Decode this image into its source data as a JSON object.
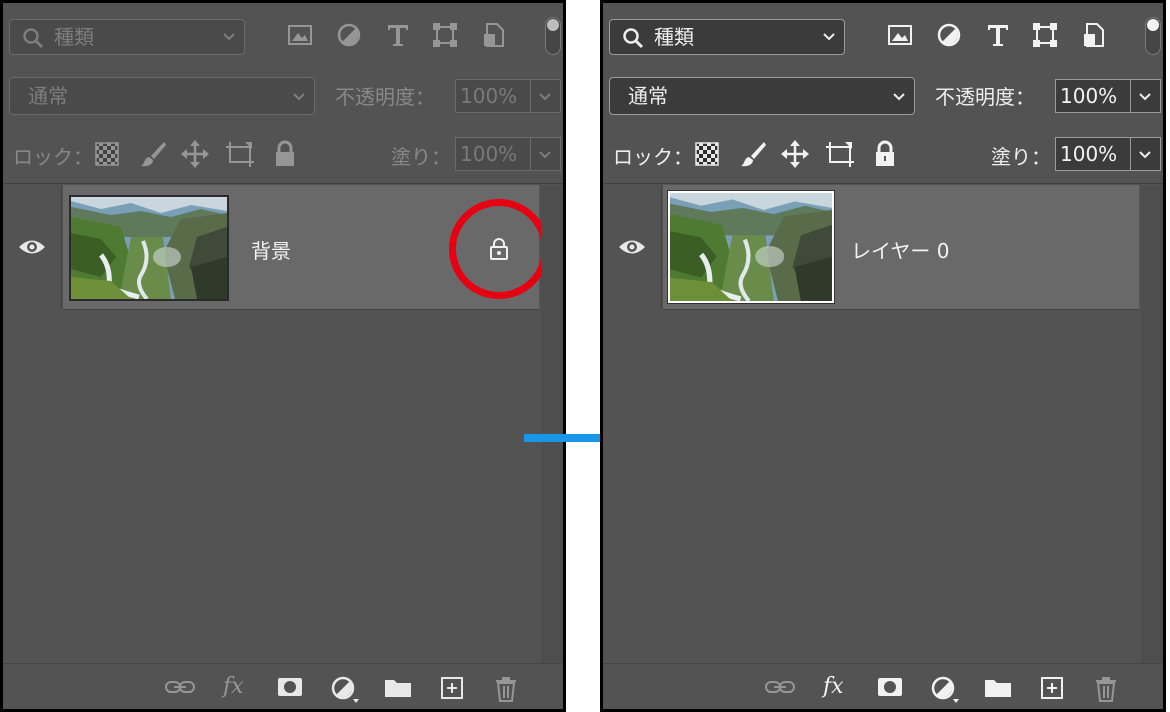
{
  "colors": {
    "panel_bg": "#535353",
    "selected_row": "#696969",
    "highlight": "#e60012",
    "arrow": "#1a96e8"
  },
  "before": {
    "filter_kind": "種類",
    "blend_mode": "通常",
    "opacity_label": "不透明度：",
    "opacity_value": "100%",
    "lock_label": "ロック：",
    "fill_label": "塗り：",
    "fill_value": "100%",
    "layer_name": "背景",
    "layer_locked": true
  },
  "after": {
    "filter_kind": "種類",
    "blend_mode": "通常",
    "opacity_label": "不透明度：",
    "opacity_value": "100%",
    "lock_label": "ロック：",
    "fill_label": "塗り：",
    "fill_value": "100%",
    "layer_name": "レイヤー 0",
    "layer_locked": false
  },
  "icons": {
    "filter": [
      "image-filter-icon",
      "adjustment-filter-icon",
      "type-filter-icon",
      "shape-filter-icon",
      "smart-object-filter-icon"
    ],
    "lock": [
      "lock-transparent-pixels-icon",
      "lock-image-pixels-icon",
      "lock-position-icon",
      "lock-artboard-icon",
      "lock-all-icon"
    ],
    "bottom": [
      "link-layers-icon",
      "fx-icon",
      "add-mask-icon",
      "adjustment-layer-icon",
      "new-group-icon",
      "new-layer-icon",
      "delete-layer-icon"
    ]
  },
  "fx_text": "fx"
}
